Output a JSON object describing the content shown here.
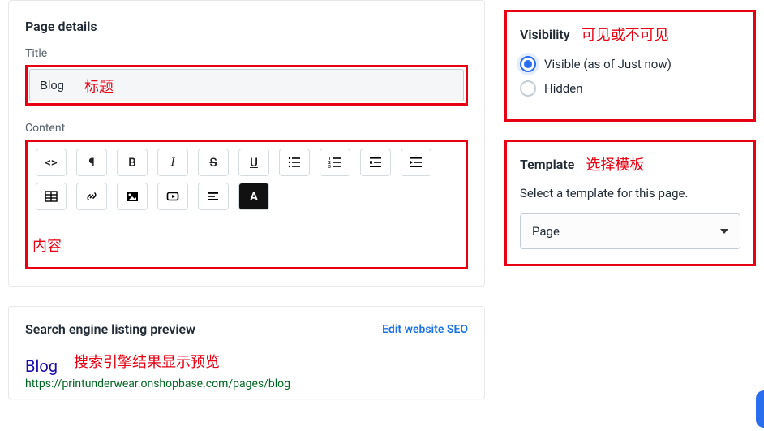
{
  "page_details": {
    "heading": "Page details",
    "title_label": "Title",
    "title_value": "Blog",
    "title_annotation": "标题",
    "content_label": "Content",
    "content_annotation": "内容"
  },
  "toolbar": {
    "code": "<>",
    "paragraph": "¶",
    "bold": "B",
    "italic": "I",
    "strike": "S",
    "underline": "U",
    "color_a": "A"
  },
  "seo": {
    "heading": "Search engine listing preview",
    "edit_link": "Edit website SEO",
    "annotation": "搜索引擎结果显示预览",
    "preview_title": "Blog",
    "preview_url": "https://printunderwear.onshopbase.com/pages/blog"
  },
  "visibility": {
    "heading": "Visibility",
    "annotation": "可见或不可见",
    "visible_label": "Visible (as of Just now)",
    "hidden_label": "Hidden"
  },
  "template": {
    "heading": "Template",
    "annotation": "选择模板",
    "help_text": "Select a template for this page.",
    "selected": "Page"
  }
}
